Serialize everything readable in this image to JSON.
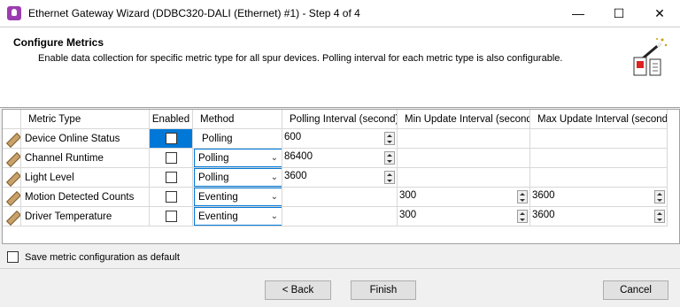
{
  "window": {
    "title": "Ethernet Gateway Wizard (DDBC320-DALI (Ethernet) #1) - Step 4 of 4",
    "min_glyph": "—",
    "max_glyph": "☐",
    "close_glyph": "✕"
  },
  "header": {
    "title": "Configure Metrics",
    "description": "Enable data collection for specific metric type for all spur devices. Polling interval for each metric type is also configurable."
  },
  "grid": {
    "columns": {
      "metric_type": "Metric Type",
      "enabled": "Enabled",
      "method": "Method",
      "polling_interval": "Polling Interval (second)",
      "min_update": "Min Update Interval (second)",
      "max_update": "Max Update Interval (second)"
    },
    "rows": [
      {
        "metric_type": "Device Online Status",
        "enabled": false,
        "method": "Polling",
        "polling_interval": "600",
        "min_update": "",
        "max_update": ""
      },
      {
        "metric_type": "Channel Runtime",
        "enabled": false,
        "method": "Polling",
        "polling_interval": "86400",
        "min_update": "",
        "max_update": ""
      },
      {
        "metric_type": "Light Level",
        "enabled": false,
        "method": "Polling",
        "polling_interval": "3600",
        "min_update": "",
        "max_update": ""
      },
      {
        "metric_type": "Motion Detected Counts",
        "enabled": false,
        "method": "Eventing",
        "polling_interval": "",
        "min_update": "300",
        "max_update": "3600"
      },
      {
        "metric_type": "Driver Temperature",
        "enabled": false,
        "method": "Eventing",
        "polling_interval": "",
        "min_update": "300",
        "max_update": "3600"
      }
    ]
  },
  "save_default_label": "Save metric configuration as default",
  "buttons": {
    "back": "< Back",
    "finish": "Finish",
    "cancel": "Cancel"
  },
  "colors": {
    "selection": "#0078d7",
    "app_icon": "#9b3db0"
  }
}
